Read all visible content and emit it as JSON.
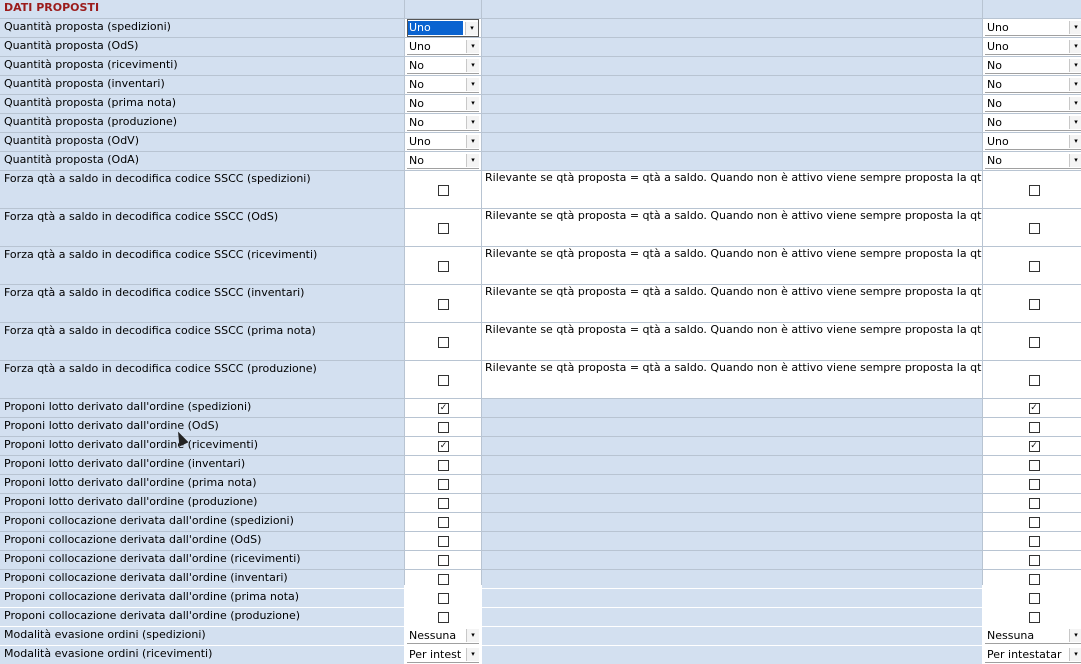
{
  "section_title": "DATI PROPOSTI",
  "dropdown_rows": [
    {
      "label": "Quantità proposta (spedizioni)",
      "value": "Uno",
      "value2": "Uno",
      "selected": true
    },
    {
      "label": "Quantità proposta (OdS)",
      "value": "Uno",
      "value2": "Uno"
    },
    {
      "label": "Quantità proposta (ricevimenti)",
      "value": "No",
      "value2": "No"
    },
    {
      "label": "Quantità proposta (inventari)",
      "value": "No",
      "value2": "No"
    },
    {
      "label": "Quantità proposta (prima nota)",
      "value": "No",
      "value2": "No"
    },
    {
      "label": "Quantità proposta (produzione)",
      "value": "No",
      "value2": "No"
    },
    {
      "label": "Quantità proposta (OdV)",
      "value": "Uno",
      "value2": "Uno"
    },
    {
      "label": "Quantità proposta (OdA)",
      "value": "No",
      "value2": "No"
    }
  ],
  "sscc_description": "Rilevante se qtà proposta = qtà a saldo. Quando non è attivo viene sempre proposta la qtà derivata dall'anagrafica SSCC",
  "sscc_rows": [
    {
      "label": "Forza qtà a saldo in decodifica codice SSCC (spedizioni)",
      "checked": false,
      "checked2": false
    },
    {
      "label": "Forza qtà a saldo in decodifica codice SSCC (OdS)",
      "checked": false,
      "checked2": false
    },
    {
      "label": "Forza qtà a saldo in decodifica codice SSCC (ricevimenti)",
      "checked": false,
      "checked2": false
    },
    {
      "label": "Forza qtà a saldo in decodifica codice SSCC (inventari)",
      "checked": false,
      "checked2": false
    },
    {
      "label": "Forza qtà a saldo in decodifica codice SSCC (prima nota)",
      "checked": false,
      "checked2": false
    },
    {
      "label": "Forza qtà a saldo in decodifica codice SSCC (produzione)",
      "checked": false,
      "checked2": false
    }
  ],
  "check_rows": [
    {
      "label": "Proponi lotto derivato dall'ordine (spedizioni)",
      "checked": true,
      "checked2": true
    },
    {
      "label": "Proponi lotto derivato dall'ordine (OdS)",
      "checked": false,
      "checked2": false
    },
    {
      "label": "Proponi lotto derivato dall'ordine (ricevimenti)",
      "checked": true,
      "checked2": true
    },
    {
      "label": "Proponi lotto derivato dall'ordine (inventari)",
      "checked": false,
      "checked2": false
    },
    {
      "label": "Proponi lotto derivato dall'ordine (prima nota)",
      "checked": false,
      "checked2": false
    },
    {
      "label": "Proponi lotto derivato dall'ordine (produzione)",
      "checked": false,
      "checked2": false
    },
    {
      "label": "Proponi collocazione derivata dall'ordine (spedizioni)",
      "checked": false,
      "checked2": false
    },
    {
      "label": "Proponi collocazione derivata dall'ordine (OdS)",
      "checked": false,
      "checked2": false
    },
    {
      "label": "Proponi collocazione derivata dall'ordine (ricevimenti)",
      "checked": false,
      "checked2": false
    },
    {
      "label": "Proponi collocazione derivata dall'ordine (inventari)",
      "checked": false,
      "checked2": false
    },
    {
      "label": "Proponi collocazione derivata dall'ordine (prima nota)",
      "checked": false,
      "checked2": false
    },
    {
      "label": "Proponi collocazione derivata dall'ordine (produzione)",
      "checked": false,
      "checked2": false
    }
  ],
  "mode_rows": [
    {
      "label": "Modalità evasione ordini (spedizioni)",
      "value": "Nessuna",
      "value2": "Nessuna"
    },
    {
      "label": "Modalità evasione ordini (ricevimenti)",
      "value": "Per intest",
      "value2": "Per intestatar"
    }
  ],
  "icons": {
    "dropdown_arrow": "▾",
    "check_mark": "✓"
  }
}
